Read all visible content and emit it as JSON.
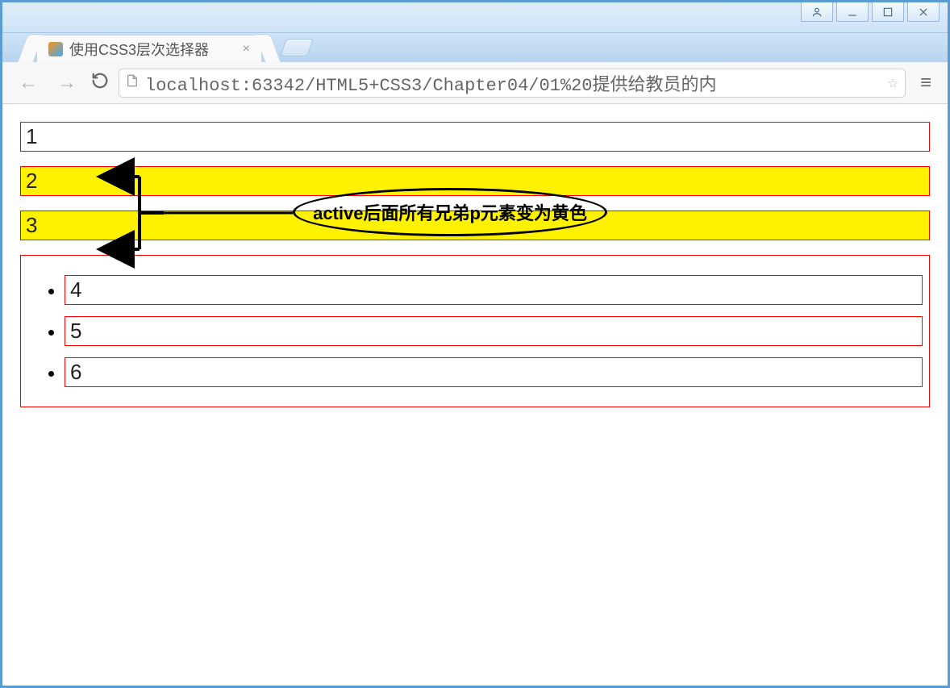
{
  "window": {
    "tab_title": "使用CSS3层次选择器",
    "url": "localhost:63342/HTML5+CSS3/Chapter04/01%20提供给教员的内"
  },
  "page": {
    "p1": "1",
    "p2": "2",
    "p3": "3",
    "li1": "4",
    "li2": "5",
    "li3": "6"
  },
  "annotation": {
    "text": "active后面所有兄弟p元素变为黄色"
  }
}
